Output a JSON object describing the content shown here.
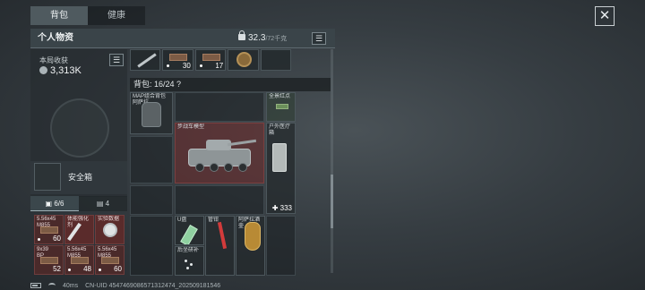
{
  "tabs": [
    {
      "label": "背包",
      "active": true
    },
    {
      "label": "健康",
      "active": false
    }
  ],
  "panel": {
    "title": "个人物资",
    "weight": "32.3",
    "weight_max": "/72千克"
  },
  "income": {
    "label": "本局收获",
    "value": "3,313K"
  },
  "safe_box": {
    "label": "安全箱"
  },
  "sub_tabs": [
    {
      "label": "6/6",
      "icon": "briefcase-icon"
    },
    {
      "label": "4",
      "icon": "card-icon"
    }
  ],
  "pocket_items": [
    {
      "name": "5.56x45\nM855",
      "qty": "60",
      "icon": "ammo-icon"
    },
    {
      "name": "体能强化剂",
      "qty": "",
      "icon": "syringe-icon"
    },
    {
      "name": "实验数据",
      "qty": "",
      "icon": "disc-icon"
    },
    {
      "name": "9x39\nBP",
      "qty": "52",
      "icon": "ammo-icon"
    },
    {
      "name": "5.56x45\nM855",
      "qty": "48",
      "icon": "ammo-icon"
    },
    {
      "name": "5.56x45\nM855",
      "qty": "60",
      "icon": "ammo-icon"
    }
  ],
  "top_row": [
    {
      "qty": "",
      "icon": "rifle-icon"
    },
    {
      "qty": "30",
      "icon": "ammo-icon"
    },
    {
      "qty": "17",
      "icon": "ammo-icon"
    },
    {
      "qty": "",
      "icon": "medal-icon"
    }
  ],
  "backpack": {
    "label": "背包: 16/24",
    "help": "?",
    "items": {
      "bag": {
        "name": "MAP组合背包\n阿萨拉"
      },
      "gadget": {
        "name": "全景红点"
      },
      "vehicle": {
        "name": "步战车模型"
      },
      "medkit": {
        "name": "户外医疗箱",
        "qty": "333"
      },
      "usb": {
        "name": "U盘"
      },
      "wrench": {
        "name": "管钳"
      },
      "vase": {
        "name": "阿萨拉酒壶"
      },
      "bits": {
        "name": "后坐研补"
      }
    }
  },
  "status_bar": {
    "ping": "40ms",
    "uid": "CN-UID 4547469086571312474_202509181546"
  }
}
